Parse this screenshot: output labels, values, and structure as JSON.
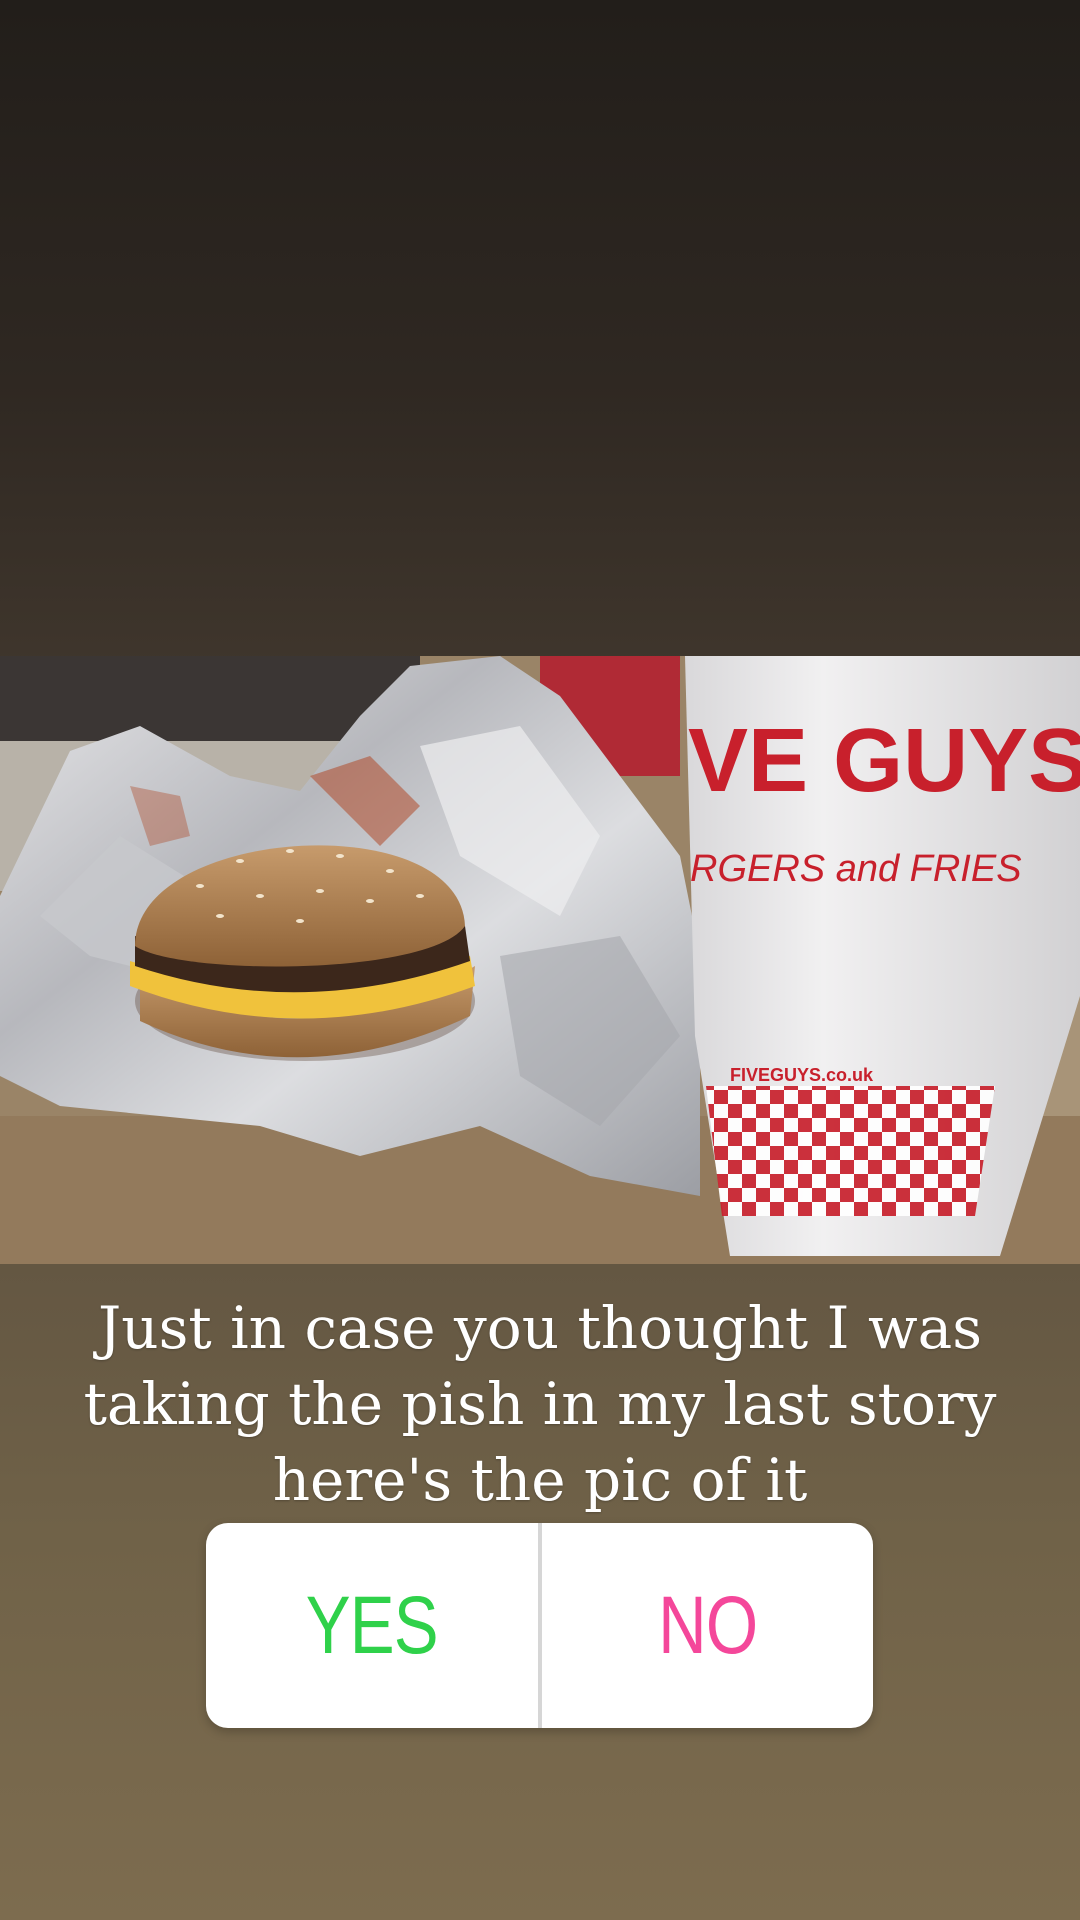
{
  "story": {
    "caption_lines": [
      "Just in case you thought I was",
      "taking the pish in my last story",
      "here's the pic of it"
    ],
    "photo": {
      "cup_brand_text": "VE GUYS",
      "cup_tagline": "RGERS and FRIES",
      "cup_website": "FIVEGUYS.co.uk"
    }
  },
  "poll": {
    "options": [
      {
        "label": "YES",
        "color": "#2fd14a"
      },
      {
        "label": "NO",
        "color": "#f4479a"
      }
    ]
  }
}
